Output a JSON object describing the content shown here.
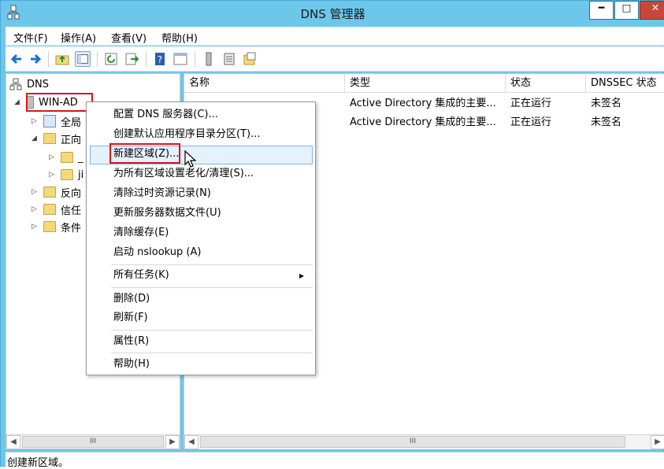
{
  "window": {
    "title": "DNS 管理器",
    "controls": {
      "minimize": "━",
      "maximize": "□",
      "close": "✕"
    }
  },
  "menubar": {
    "items": [
      "文件(F)",
      "操作(A)",
      "查看(V)",
      "帮助(H)"
    ]
  },
  "toolbar": {
    "icons": [
      "back-icon",
      "forward-icon",
      "up-folder-icon",
      "show-tree-icon",
      "refresh-icon",
      "export-icon",
      "help-icon",
      "console-icon",
      "server-icon",
      "list-icon",
      "properties-icon"
    ]
  },
  "tree": {
    "root": "DNS",
    "server": "WIN-AD",
    "items": [
      "全局",
      "正向",
      "_",
      "ji",
      "反向",
      "信任",
      "条件"
    ]
  },
  "list": {
    "columns": [
      "名称",
      "类型",
      "状态",
      "DNSSEC 状态"
    ],
    "rows": [
      {
        "type": "Active Directory 集成的主要...",
        "status": "正在运行",
        "dnssec": "未签名"
      },
      {
        "type": "Active Directory 集成的主要...",
        "status": "正在运行",
        "dnssec": "未签名"
      }
    ]
  },
  "context_menu": {
    "items": [
      "配置 DNS 服务器(C)...",
      "创建默认应用程序目录分区(T)...",
      "新建区域(Z)...",
      "为所有区域设置老化/清理(S)...",
      "清除过时资源记录(N)",
      "更新服务器数据文件(U)",
      "清除缓存(E)",
      "启动 nslookup (A)",
      "所有任务(K)",
      "删除(D)",
      "刷新(F)",
      "属性(R)",
      "帮助(H)"
    ],
    "highlighted": "新建区域(Z)...",
    "submenu_arrow": "▸"
  },
  "scrollbars": {
    "thumb_label": "III"
  },
  "status_bar": {
    "text": "创建新区域。"
  }
}
